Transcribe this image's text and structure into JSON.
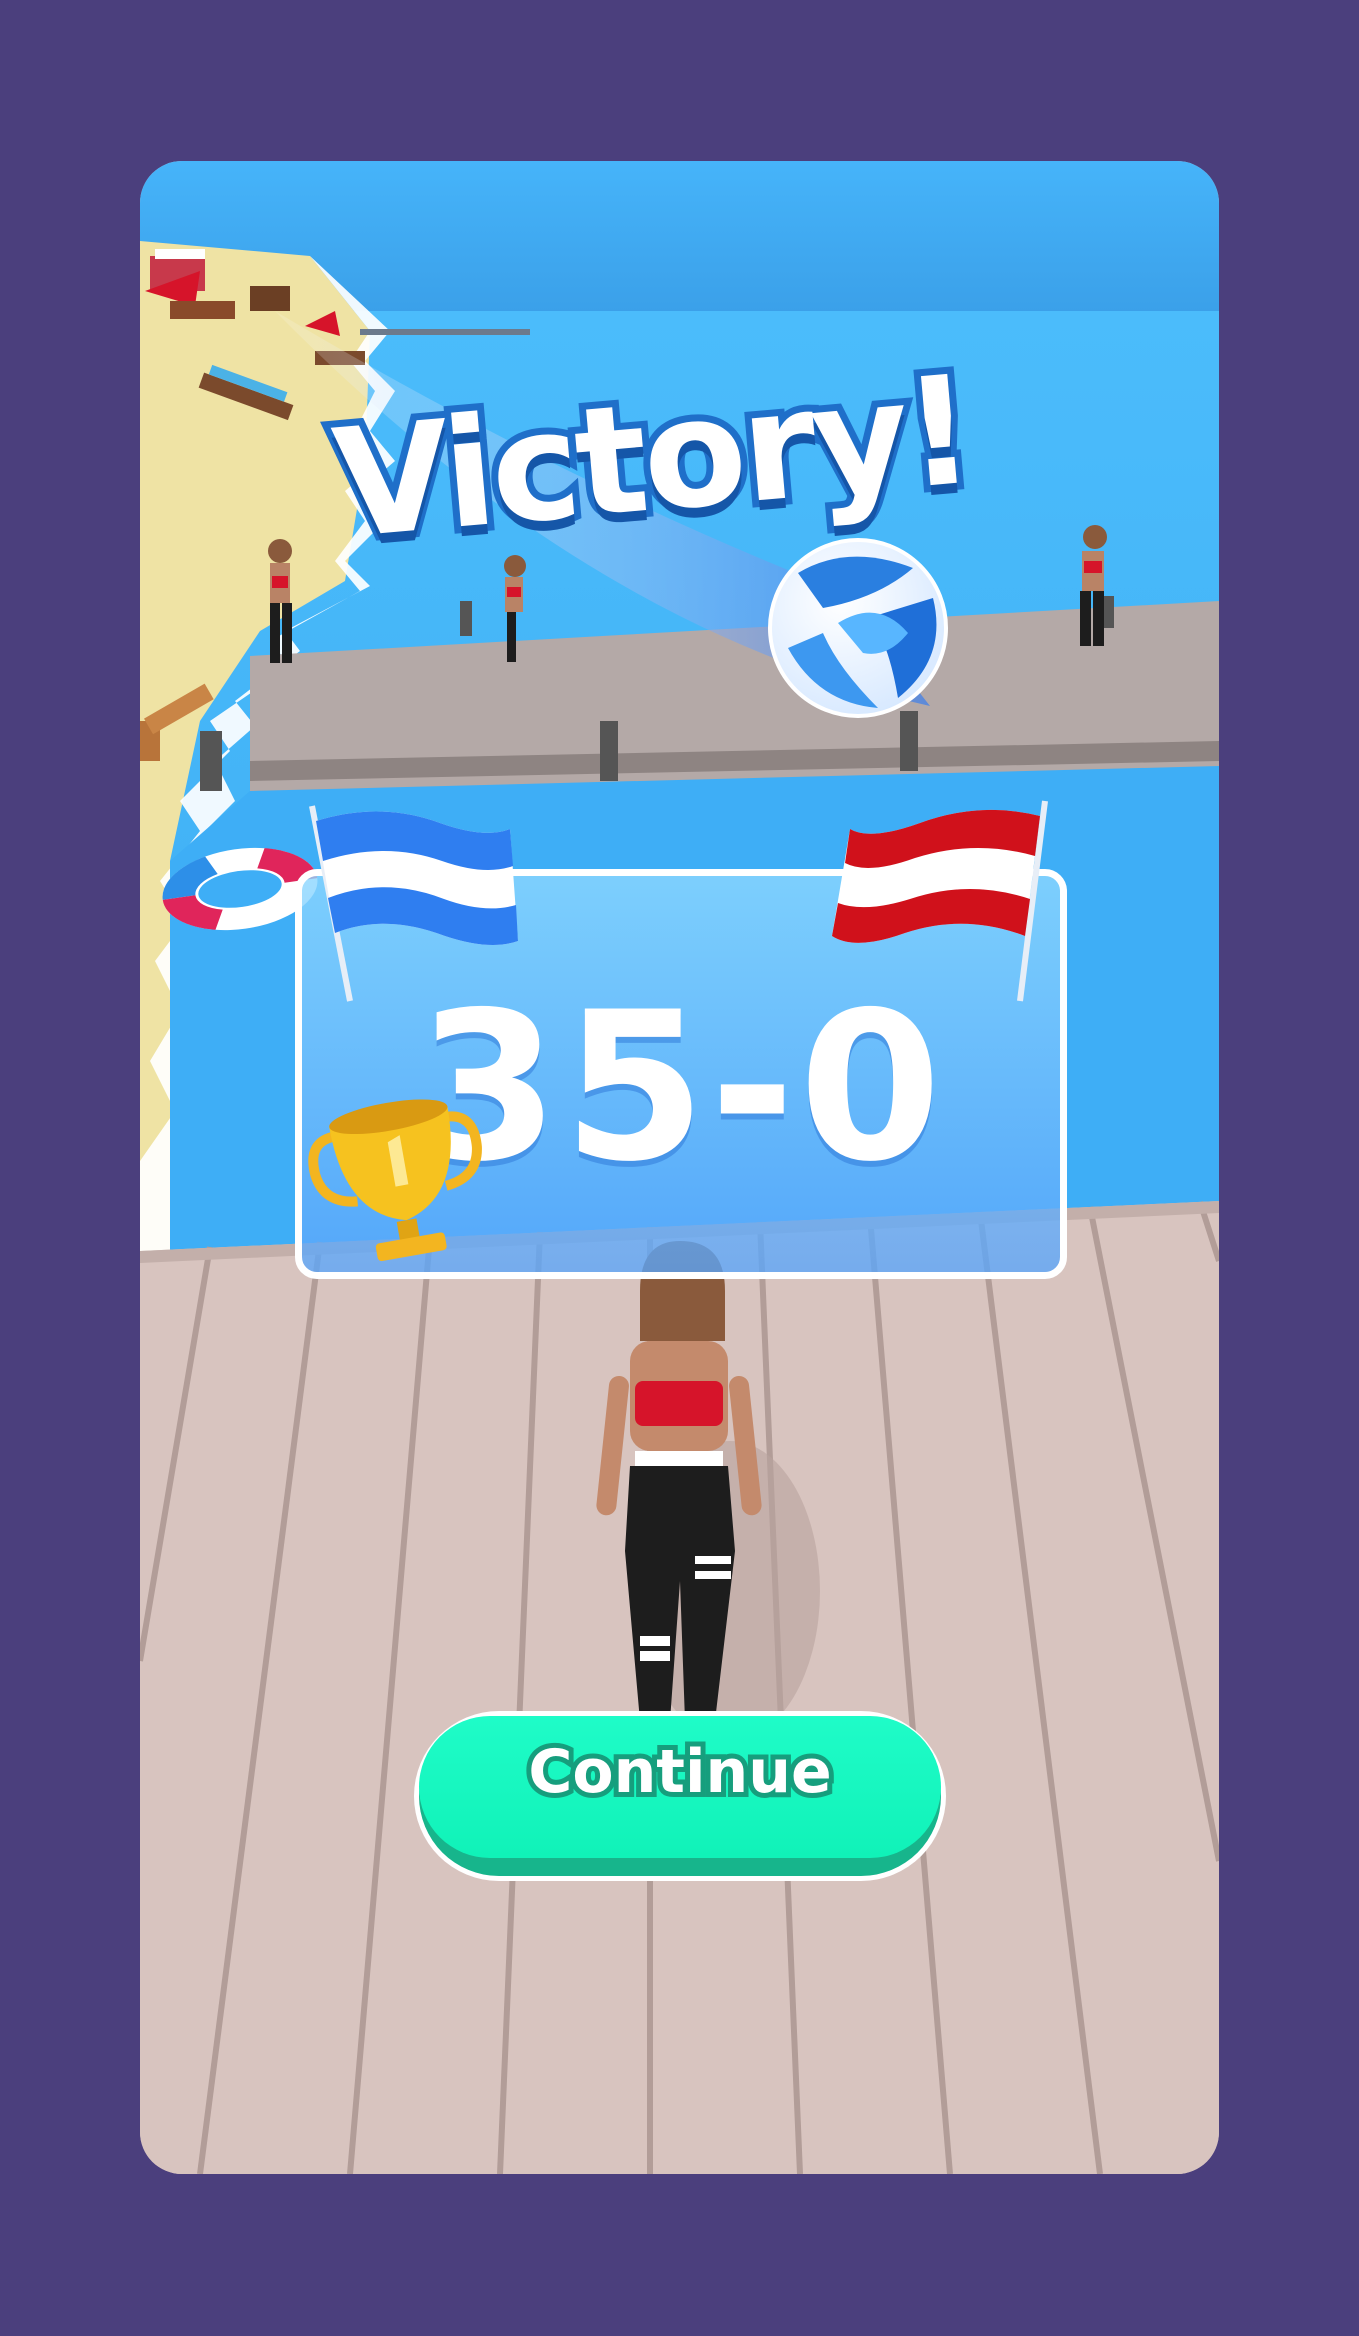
{
  "title": "Victory!",
  "score": "35-0",
  "continue_label": "Continue",
  "colors": {
    "background": "#4b3f7d",
    "sky": "#46b3f7",
    "water": "#3eaef6",
    "sand": "#efe3a4",
    "dock": "#d6c2bd",
    "title_fill": "#ffffff",
    "title_stroke": "#1f6fc9",
    "flag_player": "#2f7ef0",
    "flag_opponent": "#d0111b",
    "trophy": "#f3b520",
    "button": "#10f2b8",
    "button_shadow": "#17b58c"
  },
  "icons": [
    "player-flag-icon",
    "opponent-flag-icon",
    "trophy-icon",
    "volleyball-icon"
  ]
}
